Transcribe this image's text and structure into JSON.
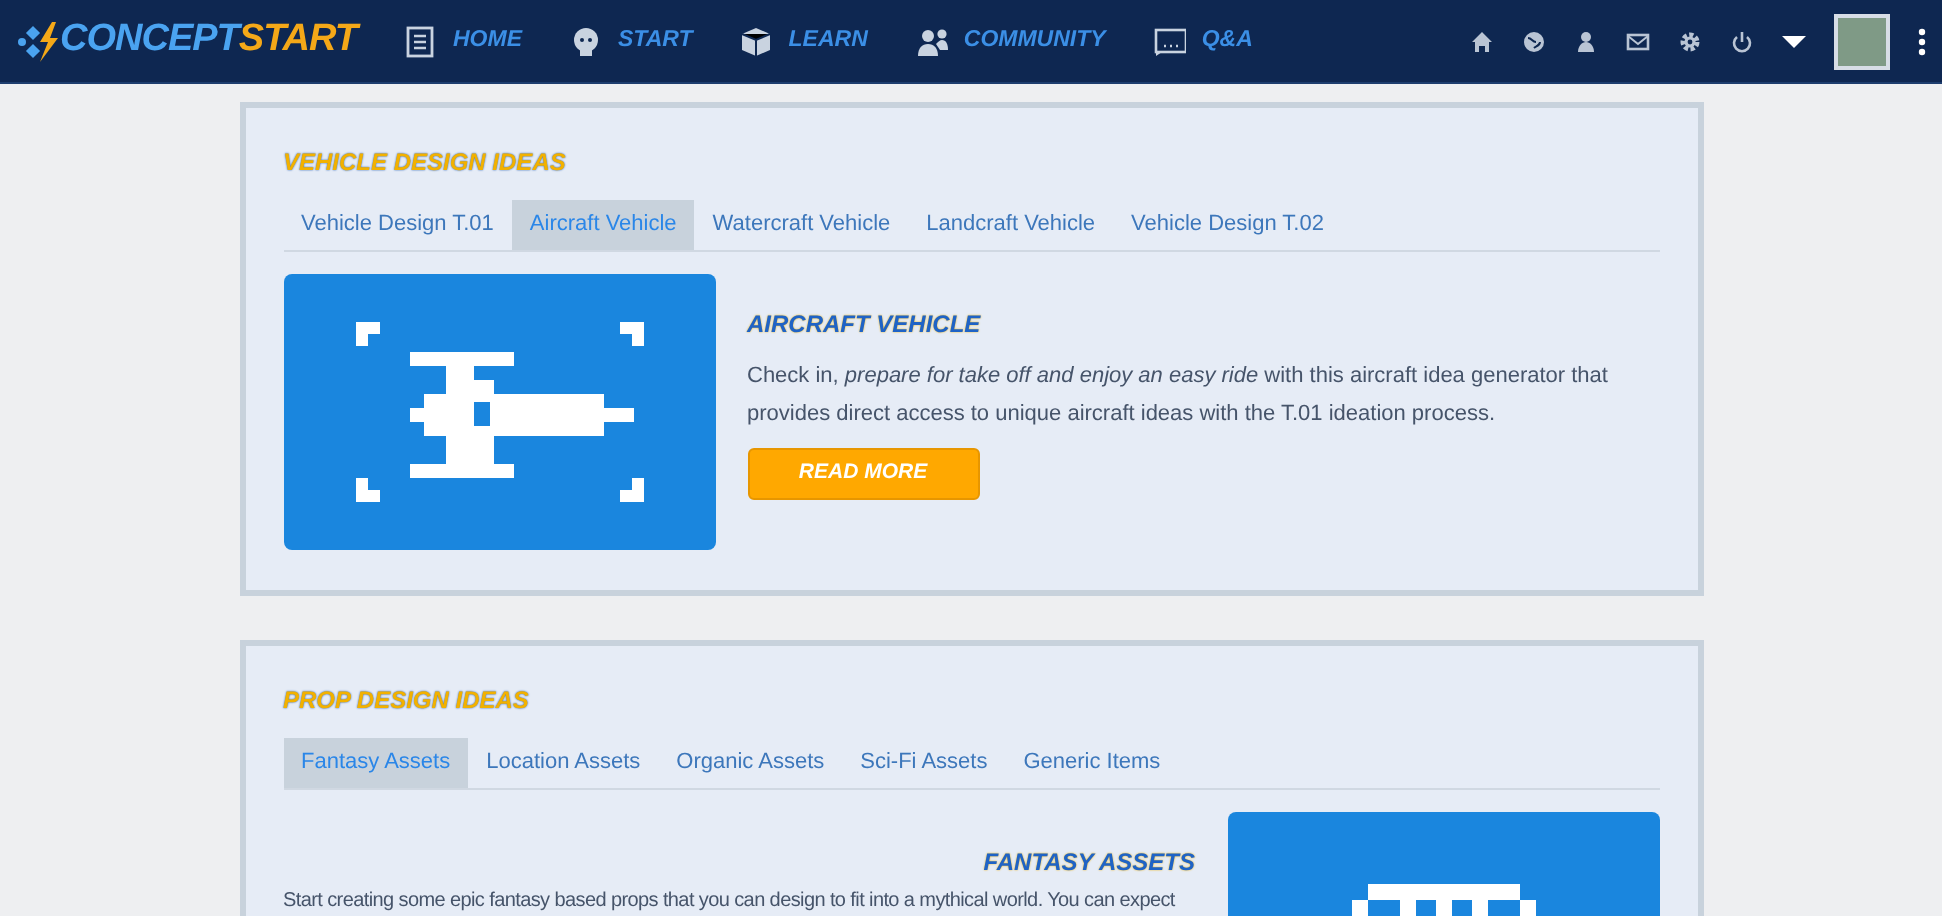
{
  "navbar": {
    "brand": {
      "first": "CONCEPT",
      "second": "START"
    },
    "links": [
      {
        "label": "HOME"
      },
      {
        "label": "START"
      },
      {
        "label": "LEARN"
      },
      {
        "label": "COMMUNITY"
      },
      {
        "label": "Q&A"
      }
    ]
  },
  "sections": [
    {
      "title": "VEHICLE DESIGN IDEAS",
      "tabs": [
        {
          "label": "Vehicle Design T.01",
          "selected": false
        },
        {
          "label": "Aircraft Vehicle",
          "selected": true
        },
        {
          "label": "Watercraft Vehicle",
          "selected": false
        },
        {
          "label": "Landcraft Vehicle",
          "selected": false
        },
        {
          "label": "Vehicle Design T.02",
          "selected": false
        }
      ],
      "feature": {
        "title": "AIRCRAFT VEHICLE",
        "text": "Check in, *prepare for take off and enjoy an easy ride* with this aircraft idea generator that provides direct access to unique aircraft ideas with the T.01 ideation process.",
        "button": "READ MORE"
      }
    },
    {
      "title": "PROP DESIGN IDEAS",
      "tabs": [
        {
          "label": "Fantasy Assets",
          "selected": true
        },
        {
          "label": "Location Assets",
          "selected": false
        },
        {
          "label": "Organic Assets",
          "selected": false
        },
        {
          "label": "Sci-Fi Assets",
          "selected": false
        },
        {
          "label": "Generic Items",
          "selected": false
        }
      ],
      "feature": {
        "title": "FANTASY ASSETS",
        "text": "Start creating some epic fantasy based props that you can design to fit into a mythical world. You can expect"
      }
    }
  ]
}
